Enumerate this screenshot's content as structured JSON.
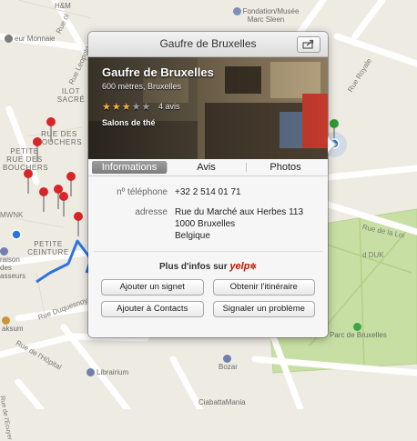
{
  "map": {
    "districts": [
      "ILOT SACRÉ",
      "RUE DES BOUCHERS",
      "PETITE RUE DES BOUCHERS",
      "PETITE CEINTURE"
    ],
    "streets": [
      "Rue Leopold",
      "Rue Royale",
      "Rue de la Loi",
      "Rue Duquesnoy",
      "Rue de l'Hôpital",
      "Rue de l'Ecuyer"
    ],
    "partial_labels": [
      "eur Monnaie",
      "MWNK",
      "d DUK",
      "Rue ol"
    ],
    "pois": [
      "H&M",
      "Fondation/Musée Marc Sleen",
      "Librairium",
      "Bozar",
      "CiabattaMania",
      "Parc de Bruxelles",
      "aksum",
      "raison des asseurs",
      "Bruxelles"
    ]
  },
  "popover": {
    "title": "Gaufre de Bruxelles",
    "name": "Gaufre de Bruxelles",
    "distance": "600 mètres, Bruxelles",
    "rating": 3,
    "rating_max": 5,
    "stars": "★★★",
    "stars_off": "★★",
    "reviews": "4 avis",
    "category": "Salons de thé",
    "tabs": [
      "Informations",
      "Avis",
      "Photos"
    ],
    "phone_label": "nº téléphone",
    "phone": "+32 2 514 01 71",
    "address_label": "adresse",
    "address_lines": [
      "Rue du Marché aux Herbes 113",
      "1000 Bruxelles",
      "Belgique"
    ],
    "more_info": "Plus d'infos sur",
    "yelp": "yelp",
    "buttons": [
      "Ajouter un signet",
      "Obtenir l'itinéraire",
      "Ajouter à Contacts",
      "Signaler un problème"
    ]
  },
  "colors": {
    "park": "#c8dfa4",
    "pin_red": "#d7262a",
    "pin_green": "#2f9b3a",
    "route": "#2b74e0",
    "accent": "#c41200"
  }
}
